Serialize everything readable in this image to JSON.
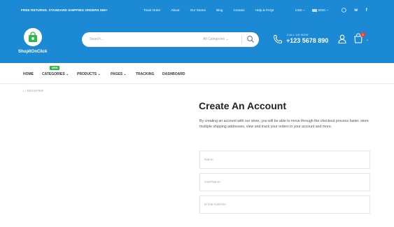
{
  "topbar": {
    "promo": "FREE RETURNS. STANDARD SHIPPING ORDERS $99+",
    "links": [
      "Track Order",
      "About",
      "Our Stores",
      "Blog",
      "Contact",
      "Help & FAQs"
    ],
    "currency": "USD ~",
    "language": "ENG ~",
    "social_icons": [
      "instagram-icon",
      "twitter-icon",
      "facebook-icon"
    ]
  },
  "header": {
    "logo_text": "ShopItOnClick",
    "search_placeholder": "Search...",
    "category_select": "All Categories",
    "call_label": "CALL US NOW",
    "phone": "+123 5678 890",
    "cart_count": "0",
    "brand_color": "#1b89d4"
  },
  "nav": {
    "items": [
      "HOME",
      "CATEGORIES",
      "PRODUCTS",
      "PAGES",
      "TRACKING",
      "DASHBOARD"
    ],
    "badge": "NEW"
  },
  "breadcrumb": {
    "current": "REGISTER"
  },
  "form": {
    "title": "Create An Account",
    "description": "By creating an account with our store, you will be able to move through the checkout process faster, store multiple shipping addresses, view and track your orders in your account and more.",
    "fields": [
      {
        "placeholder": "Name"
      },
      {
        "placeholder": "UserName"
      },
      {
        "placeholder": "Email Address"
      }
    ]
  }
}
